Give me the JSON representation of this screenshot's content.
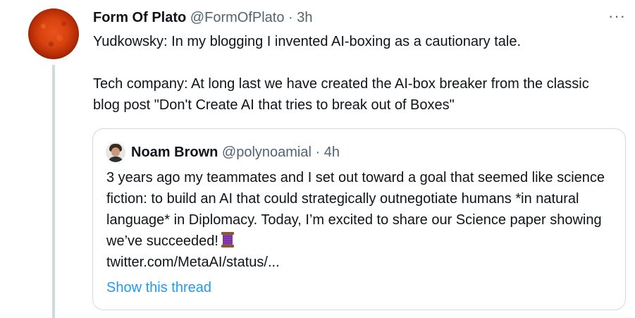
{
  "tweet": {
    "author_name": "Form Of Plato",
    "author_handle": "@FormOfPlato",
    "separator": "·",
    "time": "3h",
    "more_label": "···",
    "text_line_1": "Yudkowsky: In my blogging I invented AI-boxing as a cautionary tale.",
    "text_line_2": "Tech company: At long last we have created the AI-box breaker from the classic blog post \"Don't Create AI that tries to break out of Boxes\""
  },
  "quoted_tweet": {
    "author_name": "Noam Brown",
    "author_handle": "@polynoamial",
    "separator": "·",
    "time": "4h",
    "text": "3 years ago my teammates and I set out toward a goal that seemed like science fiction: to build an AI that could strategically outnegotiate humans *in natural language* in Diplomacy. Today, I’m excited to share our Science paper showing we’ve succeeded!",
    "emoji": "thread-spool-emoji",
    "link_text": "twitter.com/MetaAI/status/...",
    "show_thread_label": "Show this thread"
  },
  "icons": {
    "more": "more-horizontal-icon",
    "emoji": "thread-spool-emoji"
  },
  "colors": {
    "text_primary": "#0f1419",
    "text_secondary": "#536471",
    "link_blue": "#1d9bf0",
    "border": "#cfd9de",
    "thread_line": "#cfd9de"
  }
}
